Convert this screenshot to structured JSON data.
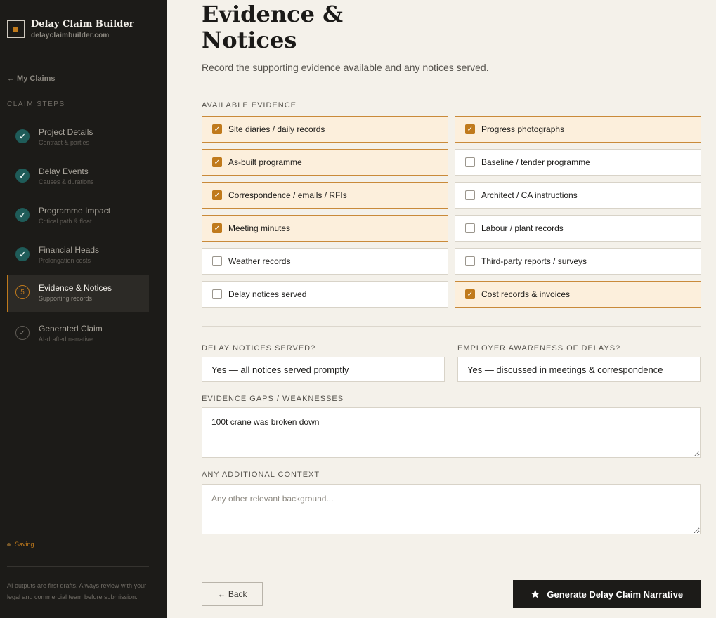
{
  "brand": {
    "name": "Delay Claim Builder",
    "url": "delayclaimbuilder.com"
  },
  "nav": {
    "back_label": "← My Claims",
    "steps_heading": "CLAIM STEPS"
  },
  "steps": [
    {
      "title": "Project Details",
      "subtitle": "Contract & parties",
      "status": "done",
      "marker": "✓"
    },
    {
      "title": "Delay Events",
      "subtitle": "Causes & durations",
      "status": "done",
      "marker": "✓"
    },
    {
      "title": "Programme Impact",
      "subtitle": "Critical path & float",
      "status": "done",
      "marker": "✓"
    },
    {
      "title": "Financial Heads",
      "subtitle": "Prolongation costs",
      "status": "done",
      "marker": "✓"
    },
    {
      "title": "Evidence & Notices",
      "subtitle": "Supporting records",
      "status": "current",
      "marker": "5"
    },
    {
      "title": "Generated Claim",
      "subtitle": "AI-drafted narrative",
      "status": "pending",
      "marker": "✓"
    }
  ],
  "status": {
    "saving": "Saving..."
  },
  "disclaimer": "AI outputs are first drafts. Always review with your legal and commercial team before submission.",
  "page": {
    "title": "Evidence & Notices",
    "subtitle": "Record the supporting evidence available and any notices served."
  },
  "evidence": {
    "label": "AVAILABLE EVIDENCE",
    "items": [
      {
        "label": "Site diaries / daily records",
        "checked": true
      },
      {
        "label": "Progress photographs",
        "checked": true
      },
      {
        "label": "As-built programme",
        "checked": true
      },
      {
        "label": "Baseline / tender programme",
        "checked": false
      },
      {
        "label": "Correspondence / emails / RFIs",
        "checked": true
      },
      {
        "label": "Architect / CA instructions",
        "checked": false
      },
      {
        "label": "Meeting minutes",
        "checked": true
      },
      {
        "label": "Labour / plant records",
        "checked": false
      },
      {
        "label": "Weather records",
        "checked": false
      },
      {
        "label": "Third-party reports / surveys",
        "checked": false
      },
      {
        "label": "Delay notices served",
        "checked": false
      },
      {
        "label": "Cost records & invoices",
        "checked": true
      }
    ]
  },
  "form": {
    "notices_label": "DELAY NOTICES SERVED?",
    "notices_value": "Yes — all notices served promptly",
    "awareness_label": "EMPLOYER AWARENESS OF DELAYS?",
    "awareness_value": "Yes — discussed in meetings & correspondence",
    "gaps_label": "EVIDENCE GAPS / WEAKNESSES",
    "gaps_value": "100t crane was broken down",
    "context_label": "ANY ADDITIONAL CONTEXT",
    "context_placeholder": "Any other relevant background..."
  },
  "actions": {
    "back_label": "← Back",
    "generate_label": "Generate Delay Claim Narrative",
    "generate_icon": "star-icon"
  },
  "colors": {
    "accent": "#c07a1c",
    "done": "#1f5c59",
    "sidebar": "#1c1b18",
    "checked_bg": "#fcefdc"
  }
}
